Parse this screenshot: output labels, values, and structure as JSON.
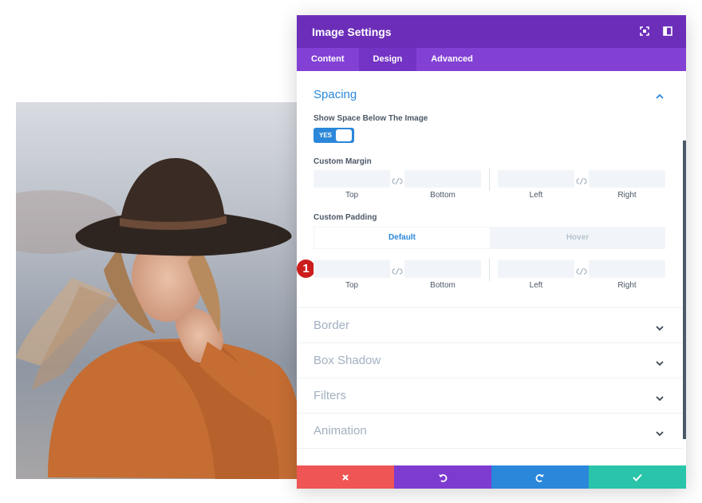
{
  "modal": {
    "title": "Image Settings",
    "tabs": [
      {
        "label": "Content"
      },
      {
        "label": "Design"
      },
      {
        "label": "Advanced"
      }
    ],
    "active_tab": "Design"
  },
  "spacing": {
    "title": "Spacing",
    "show_space_label": "Show Space Below The Image",
    "toggle_value": "YES",
    "custom_margin_label": "Custom Margin",
    "margin_labels": {
      "top": "Top",
      "bottom": "Bottom",
      "left": "Left",
      "right": "Right"
    },
    "custom_padding_label": "Custom Padding",
    "padding_states": {
      "default": "Default",
      "hover": "Hover"
    },
    "padding_labels": {
      "top": "Top",
      "bottom": "Bottom",
      "left": "Left",
      "right": "Right"
    }
  },
  "badge": {
    "number": "1"
  },
  "sections": [
    {
      "title": "Border"
    },
    {
      "title": "Box Shadow"
    },
    {
      "title": "Filters"
    },
    {
      "title": "Animation"
    }
  ],
  "colors": {
    "header": "#6c2eb9",
    "tabs": "#8241d4",
    "accent": "#2b87da",
    "cancel": "#ef5555",
    "undo": "#7e3bd0",
    "redo": "#2b87da",
    "save": "#29c4a9",
    "badge": "#cc1d1d"
  }
}
